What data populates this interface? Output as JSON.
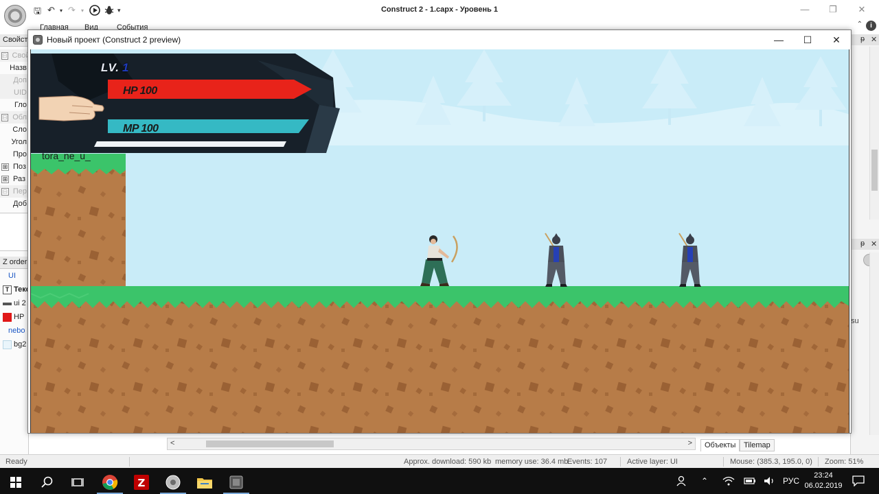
{
  "app": {
    "title": "Construct 2 - 1.capx - Уровень 1",
    "ribbon_tabs": [
      "Главная",
      "Вид",
      "События"
    ],
    "help_label": "i"
  },
  "left_panel": {
    "properties_header": "Свойст",
    "pin": "ᵽ",
    "rows": [
      {
        "toggle": "⊟",
        "label": "Свой",
        "grey": true
      },
      {
        "toggle": "",
        "label": "Назв",
        "grey": false
      },
      {
        "toggle": "",
        "label": "Доп",
        "grey": true
      },
      {
        "toggle": "",
        "label": "UID",
        "grey": true
      },
      {
        "toggle": "",
        "label": "Гло",
        "grey": false
      },
      {
        "toggle": "⊟",
        "label": "Обл",
        "grey": true
      },
      {
        "toggle": "",
        "label": "Сло",
        "grey": false
      },
      {
        "toggle": "",
        "label": "Угол",
        "grey": false
      },
      {
        "toggle": "",
        "label": "Про",
        "grey": false
      },
      {
        "toggle": "⊞",
        "label": "Поз",
        "grey": false
      },
      {
        "toggle": "⊞",
        "label": "Раз",
        "grey": false
      },
      {
        "toggle": "⊟",
        "label": "Пер",
        "grey": true
      },
      {
        "toggle": "",
        "label": "Доб",
        "grey": false
      }
    ],
    "zorder_header": "Z order",
    "zorder_items": [
      {
        "label": "UI",
        "icon": "none",
        "color": "#1a56c4"
      },
      {
        "label": "Текс",
        "icon": "text-object-icon",
        "color": "#222222"
      },
      {
        "label": "ui 2",
        "icon": "sprite-icon",
        "color": "#222222"
      },
      {
        "label": "HP",
        "icon": "red-square-icon",
        "color": "#222222"
      },
      {
        "label": "nebo",
        "icon": "none",
        "color": "#1a56c4"
      },
      {
        "label": "bg2",
        "icon": "tiled-bg-icon",
        "color": "#222222"
      }
    ]
  },
  "right_panel": {
    "pin": "ᵽ",
    "close": "✕",
    "fragment": "su"
  },
  "editor": {
    "scroll_left": "<",
    "scroll_right": ">",
    "tabs": [
      "Объекты",
      "Tilemap"
    ]
  },
  "status": {
    "ready": "Ready",
    "download": "Approx. download: 590 kb",
    "memory": "memory use: 36.4 mb",
    "events": "Events: 107",
    "active_layer": "Active layer: UI",
    "mouse": "Mouse: (385.3, 195.0, 0)",
    "zoom": "Zoom: 51%"
  },
  "preview": {
    "title": "Новый проект (Construct 2 preview)",
    "hud": {
      "lv_label": "LV.",
      "lv_value": "1",
      "hp_text": "HP 100",
      "mp_text": "MP 100",
      "hp": 100,
      "mp": 100
    },
    "player_name": "tora_ne_u_",
    "colors": {
      "sky": "#c9ecf8",
      "grass": "#3bc46a",
      "dirt": "#b77c48",
      "hp_bar": "#e8231a",
      "mp_bar": "#35b9c4"
    }
  },
  "taskbar": {
    "lang": "РУС",
    "time": "23:24",
    "date": "06.02.2019"
  }
}
